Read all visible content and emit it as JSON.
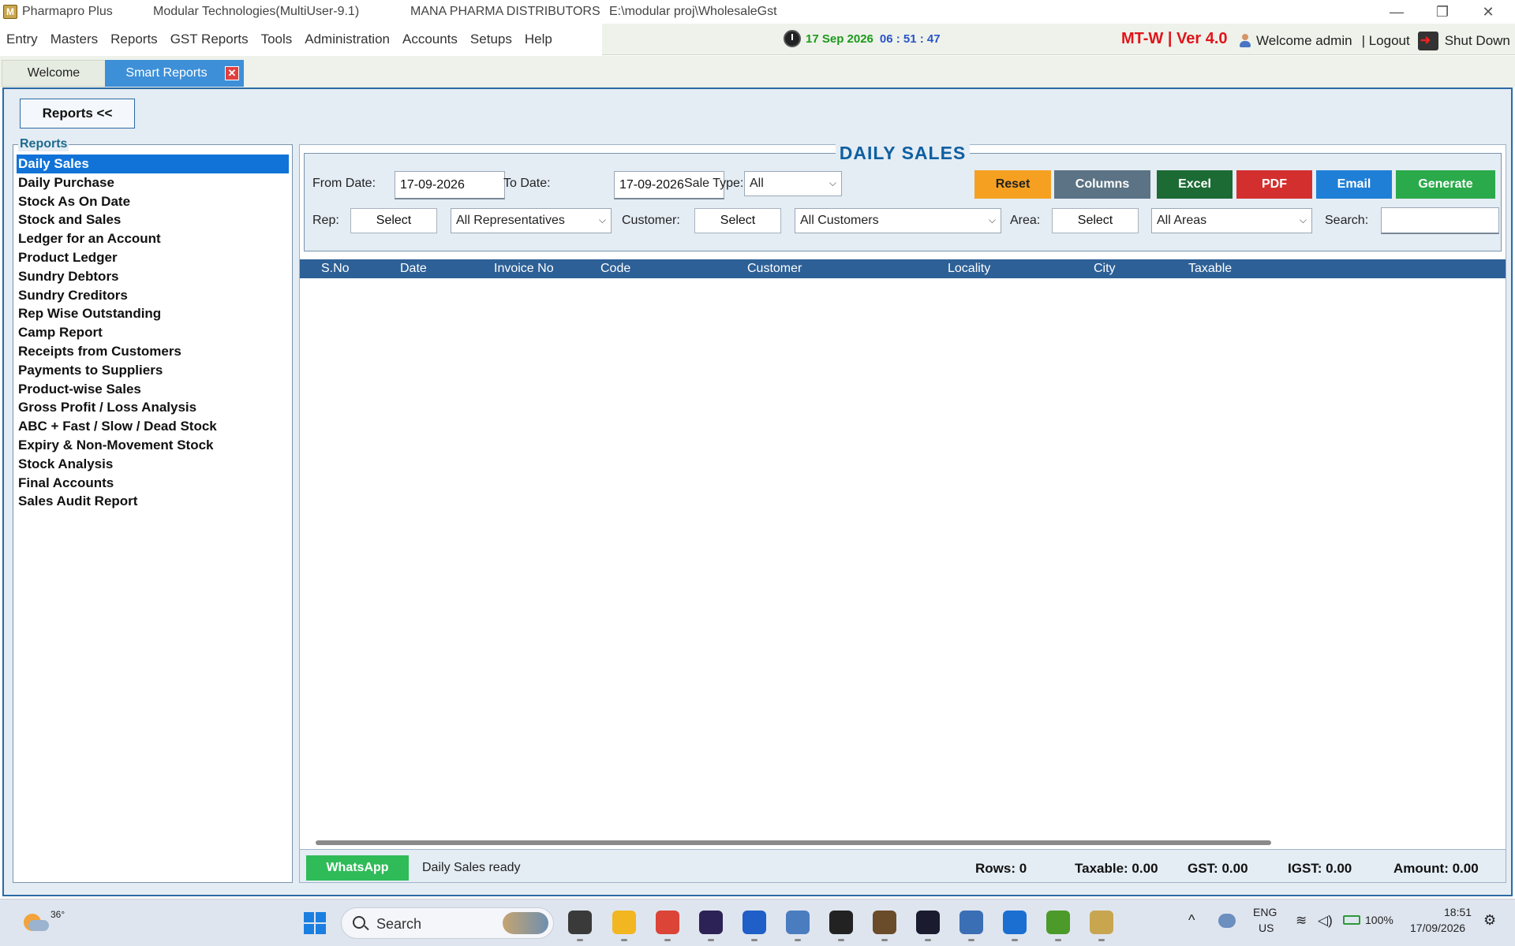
{
  "window": {
    "app_name": "Pharmapro Plus",
    "system": "Modular Technologies(MultiUser-9.1)",
    "company": "MANA PHARMA DISTRIBUTORS",
    "path": "E:\\modular proj\\WholesaleGst",
    "minimize": "—",
    "restore": "❐",
    "close": "✕"
  },
  "menu": {
    "items": [
      "Entry",
      "Masters",
      "Reports",
      "GST Reports",
      "Tools",
      "Administration",
      "Accounts",
      "Setups",
      "Help"
    ],
    "clock_date": "17 Sep 2026",
    "clock_time": "06 : 51 : 47",
    "version": "MT-W | Ver 4.0",
    "welcome": "Welcome admin",
    "logout": "| Logout",
    "shutdown": "Shut Down"
  },
  "tabs": [
    {
      "label": "Welcome"
    },
    {
      "label": "Smart Reports",
      "close": "✕"
    }
  ],
  "reports_toggle": "Reports <<",
  "sidebar": {
    "legend": "Reports",
    "items": [
      "Daily Sales",
      "Daily Purchase",
      "Stock As On Date",
      "Stock and Sales",
      "Ledger for an Account",
      "Product Ledger",
      "Sundry Debtors",
      "Sundry Creditors",
      "Rep Wise Outstanding",
      "Camp Report",
      "Receipts from Customers",
      "Payments to Suppliers",
      "Product-wise Sales",
      "Gross Profit / Loss Analysis",
      "ABC + Fast / Slow / Dead Stock",
      "Expiry & Non-Movement Stock",
      "Stock Analysis",
      "Final Accounts",
      "Sales Audit Report"
    ],
    "active_index": 0
  },
  "panel": {
    "title": "DAILY SALES",
    "from_date_label": "From Date:",
    "from_date": "17-09-2026",
    "to_date_label": "To Date:",
    "to_date": "17-09-2026",
    "sale_type_label": "Sale Type:",
    "sale_type": "All",
    "rep_label": "Rep:",
    "rep_select": "Select",
    "rep_value": "All Representatives",
    "customer_label": "Customer:",
    "customer_select": "Select",
    "customer_value": "All Customers",
    "area_label": "Area:",
    "area_select": "Select",
    "area_value": "All Areas",
    "search_label": "Search:",
    "search_value": "",
    "caret": "⌵"
  },
  "actions": [
    {
      "label": "Reset",
      "color": "#f5a021",
      "text": "#222222"
    },
    {
      "label": "Columns",
      "color": "#5b7384",
      "text": "#ffffff"
    },
    {
      "label": "Excel",
      "color": "#1c6b34",
      "text": "#ffffff"
    },
    {
      "label": "PDF",
      "color": "#d42f2f",
      "text": "#ffffff"
    },
    {
      "label": "Email",
      "color": "#1f7fd6",
      "text": "#ffffff"
    },
    {
      "label": "Generate",
      "color": "#2aaa4a",
      "text": "#ffffff"
    }
  ],
  "grid": {
    "columns": [
      "S.No",
      "Date",
      "Invoice No",
      "Code",
      "Customer",
      "Locality",
      "City",
      "Taxable"
    ],
    "rows": []
  },
  "footer": {
    "whatsapp": "WhatsApp",
    "status": "Daily Sales ready",
    "rows": "Rows: 0",
    "taxable": "Taxable: 0.00",
    "gst": "GST: 0.00",
    "igst": "IGST: 0.00",
    "amount": "Amount: 0.00"
  },
  "taskbar": {
    "temperature": "36°",
    "search": "Search",
    "lang": "ENG",
    "region": "US",
    "battery": "100%",
    "time": "18:51",
    "date": "17/09/2026"
  }
}
